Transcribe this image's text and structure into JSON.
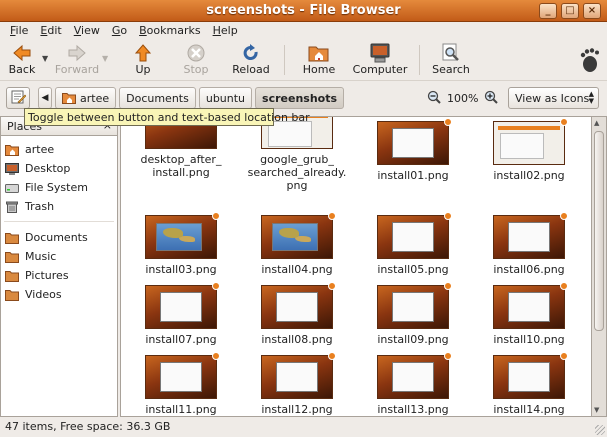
{
  "window": {
    "title": "screenshots - File Browser"
  },
  "window_controls": [
    "_",
    "□",
    "×"
  ],
  "menu": [
    {
      "pre": "",
      "mn": "F",
      "post": "ile"
    },
    {
      "pre": "",
      "mn": "E",
      "post": "dit"
    },
    {
      "pre": "",
      "mn": "V",
      "post": "iew"
    },
    {
      "pre": "",
      "mn": "G",
      "post": "o"
    },
    {
      "pre": "",
      "mn": "B",
      "post": "ookmarks"
    },
    {
      "pre": "",
      "mn": "H",
      "post": "elp"
    }
  ],
  "toolbar": {
    "back": "Back",
    "forward": "Forward",
    "up": "Up",
    "stop": "Stop",
    "reload": "Reload",
    "home": "Home",
    "computer": "Computer",
    "search": "Search"
  },
  "location": {
    "crumbs": [
      "artee",
      "Documents",
      "ubuntu",
      "screenshots"
    ],
    "zoom": "100%",
    "view_mode": "View as Icons"
  },
  "tooltip": "Toggle between button and text-based location bar",
  "sidebar": {
    "header": "Places",
    "close": "×",
    "items": [
      {
        "label": "artee",
        "icon": "home-folder-icon",
        "color": "#e58a3c"
      },
      {
        "label": "Desktop",
        "icon": "desktop-icon",
        "color": "#7c7c7c"
      },
      {
        "label": "File System",
        "icon": "filesystem-icon",
        "color": "#999999"
      },
      {
        "label": "Trash",
        "icon": "trash-icon",
        "color": "#777777"
      }
    ],
    "bookmarks": [
      {
        "label": "Documents",
        "icon": "folder-icon",
        "color": "#d9893f"
      },
      {
        "label": "Music",
        "icon": "folder-icon",
        "color": "#d9893f"
      },
      {
        "label": "Pictures",
        "icon": "folder-icon",
        "color": "#d9893f"
      },
      {
        "label": "Videos",
        "icon": "folder-icon",
        "color": "#d9893f"
      }
    ]
  },
  "files": [
    {
      "name": [
        "desktop_after_",
        "install.png"
      ],
      "style": "dark-partial"
    },
    {
      "name": [
        "google_grub_",
        "searched_already.",
        "png"
      ],
      "style": "light-partial"
    },
    {
      "name": [
        "install01.png"
      ],
      "style": "dark-window"
    },
    {
      "name": [
        "install02.png"
      ],
      "style": "light"
    },
    {
      "name": [
        "install03.png"
      ],
      "style": "map"
    },
    {
      "name": [
        "install04.png"
      ],
      "style": "map"
    },
    {
      "name": [
        "install05.png"
      ],
      "style": "dark-window"
    },
    {
      "name": [
        "install06.png"
      ],
      "style": "dark-window"
    },
    {
      "name": [
        "install07.png"
      ],
      "style": "dark-window"
    },
    {
      "name": [
        "install08.png"
      ],
      "style": "dark-window"
    },
    {
      "name": [
        "install09.png"
      ],
      "style": "dark-window"
    },
    {
      "name": [
        "install10.png"
      ],
      "style": "dark-window"
    },
    {
      "name": [
        "install11.png"
      ],
      "style": "dark-window"
    },
    {
      "name": [
        "install12.png"
      ],
      "style": "dark-window"
    },
    {
      "name": [
        "install13.png"
      ],
      "style": "dark-window"
    },
    {
      "name": [
        "install14.png"
      ],
      "style": "dark-window"
    }
  ],
  "status": "47 items, Free space: 36.3 GB",
  "colors": {
    "accent": "#d96a1f",
    "tooltip_bg": "#f9f5b7",
    "selected_crumb_bg": "#d8d1c9"
  }
}
